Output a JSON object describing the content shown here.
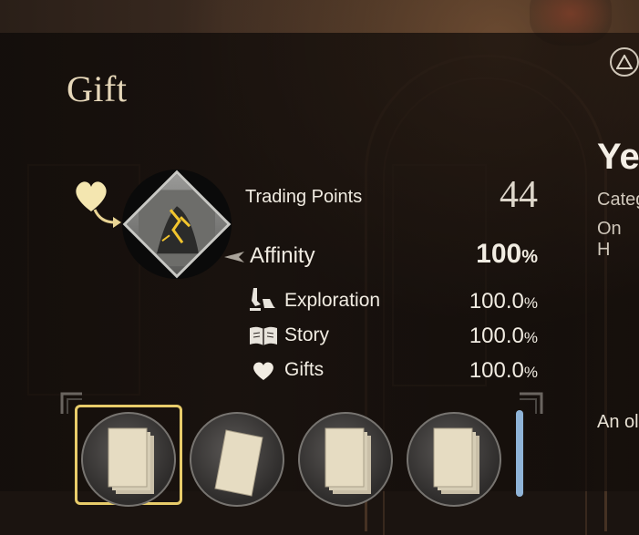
{
  "header": {
    "title": "Gift"
  },
  "stats": {
    "trading_points": {
      "label": "Trading Points",
      "value": "44"
    },
    "affinity": {
      "label": "Affinity",
      "value": "100",
      "unit": "%"
    },
    "exploration": {
      "label": "Exploration",
      "value": "100.0",
      "unit": "%"
    },
    "story": {
      "label": "Story",
      "value": "100.0",
      "unit": "%"
    },
    "gifts": {
      "label": "Gifts",
      "value": "100.0",
      "unit": "%"
    }
  },
  "right_panel": {
    "title": "Ye",
    "line1": "Categ",
    "line2": "On H",
    "line3": "An ol"
  },
  "items": [
    {
      "icon": "book-stack-icon",
      "selected": true
    },
    {
      "icon": "book-icon",
      "selected": false
    },
    {
      "icon": "book-stack-icon",
      "selected": false
    },
    {
      "icon": "book-stack-icon",
      "selected": false
    }
  ],
  "colors": {
    "accent_gold": "#e8cc6a",
    "title_color": "#e6d7b9",
    "scrollbar": "#8fb4d8"
  }
}
